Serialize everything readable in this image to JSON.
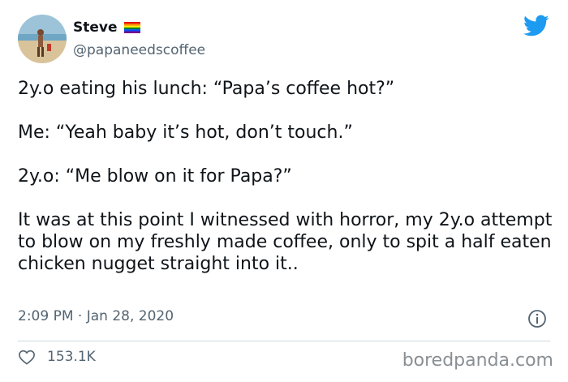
{
  "author": {
    "display_name": "Steve",
    "handle": "@papaneedscoffee"
  },
  "icons": {
    "avatar": "avatar-photo",
    "flag": "rainbow-flag-icon",
    "brand": "twitter-bird-icon",
    "info": "info-icon",
    "like": "heart-icon"
  },
  "colors": {
    "brand_blue": "#1d9bf0",
    "text": "#0f1419",
    "secondary": "#536471",
    "divider": "#cfd9de"
  },
  "tweet": {
    "paragraphs": [
      "2y.o eating his lunch: “Papa’s coffee hot?”",
      "Me: “Yeah baby it’s hot, don’t touch.”",
      "2y.o: “Me blow on it for Papa?”",
      "It was at this point I witnessed with horror, my 2y.o attempt to blow on my freshly made coffee, only to spit a half eaten chicken nugget straight into it.."
    ],
    "timestamp": "2:09 PM · Jan 28, 2020",
    "likes": "153.1K"
  },
  "watermark": "boredpanda.com"
}
